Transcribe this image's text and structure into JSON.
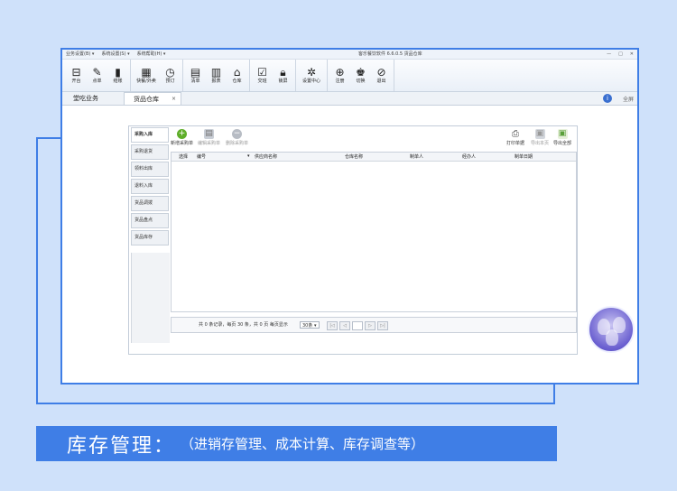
{
  "titlebar": {
    "menus": [
      "业务设置(B) ▾",
      "系统设置(S) ▾",
      "系统帮助(H) ▾"
    ],
    "title": "客乐餐饮软件 6.6.0.5 货品仓库",
    "controls": [
      "—",
      "□",
      "✕"
    ]
  },
  "ribbon": {
    "groups": [
      [
        {
          "label": "开台",
          "icon": "table-icon",
          "glyph": "⊟"
        },
        {
          "label": "点单",
          "icon": "pen-icon",
          "glyph": "✎"
        },
        {
          "label": "结账",
          "icon": "book-icon",
          "glyph": "▮"
        }
      ],
      [
        {
          "label": "快餐/外卖",
          "icon": "takeout-icon",
          "glyph": "▦"
        },
        {
          "label": "预订",
          "icon": "clock-icon",
          "glyph": "◷"
        }
      ],
      [
        {
          "label": "清单",
          "icon": "clipboard-icon",
          "glyph": "▤"
        },
        {
          "label": "报表",
          "icon": "chart-icon",
          "glyph": "▥"
        },
        {
          "label": "仓库",
          "icon": "warehouse-icon",
          "glyph": "⌂"
        }
      ],
      [
        {
          "label": "交班",
          "icon": "shift-icon",
          "glyph": "☑"
        },
        {
          "label": "锁屏",
          "icon": "lock-icon",
          "glyph": "🔒︎"
        }
      ],
      [
        {
          "label": "设置中心",
          "icon": "gear-icon",
          "glyph": "✲"
        }
      ],
      [
        {
          "label": "注册",
          "icon": "register-icon",
          "glyph": "⊕"
        },
        {
          "label": "切换",
          "icon": "switch-user-icon",
          "glyph": "♚"
        },
        {
          "label": "退出",
          "icon": "exit-icon",
          "glyph": "⊘"
        }
      ]
    ]
  },
  "tabs": {
    "tab1": "堂吃业务",
    "tab2": "货品仓库",
    "close": "×",
    "fullscreen": "全屏",
    "info": "i"
  },
  "sidenav": [
    "采购入库",
    "采购退货",
    "领料出库",
    "退料入库",
    "货品调拨",
    "货品盘点",
    "货品库存"
  ],
  "toolbar": {
    "new": "新增采购单",
    "edit": "编辑采购单",
    "delete": "删除采购单",
    "print": "打印单据",
    "export_page": "导出本页",
    "export_all": "导出全部"
  },
  "table": {
    "columns": [
      "选择",
      "编号",
      "供应商名称",
      "仓库名称",
      "制单人",
      "经办人",
      "制单日期"
    ]
  },
  "footer": {
    "stat": "共 0 条记录，每页 30 条，共 0 页  每页显示",
    "page_size": "30条 ▾",
    "pager": [
      "|◁",
      "◁",
      "",
      "▷",
      "▷|"
    ]
  },
  "banner": {
    "title": "库存管理：",
    "subtitle": "（进销存管理、成本计算、库存调查等）"
  },
  "colors": {
    "accent": "#3f7ee6",
    "background": "#cfe1fa"
  }
}
